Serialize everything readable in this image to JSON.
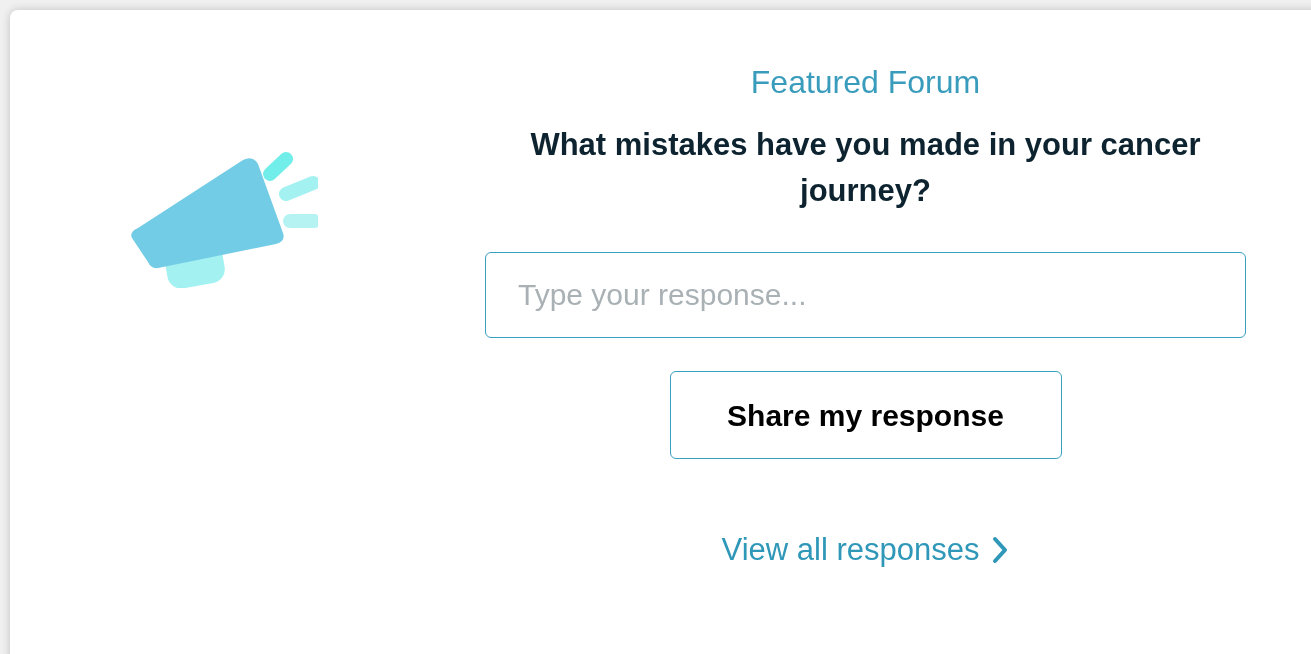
{
  "forum": {
    "eyebrow": "Featured Forum",
    "question": "What mistakes have you made in your cancer journey?",
    "response_field": {
      "placeholder": "Type your response..."
    },
    "submit_button": "Share my response",
    "view_all_link": "View all responses"
  }
}
